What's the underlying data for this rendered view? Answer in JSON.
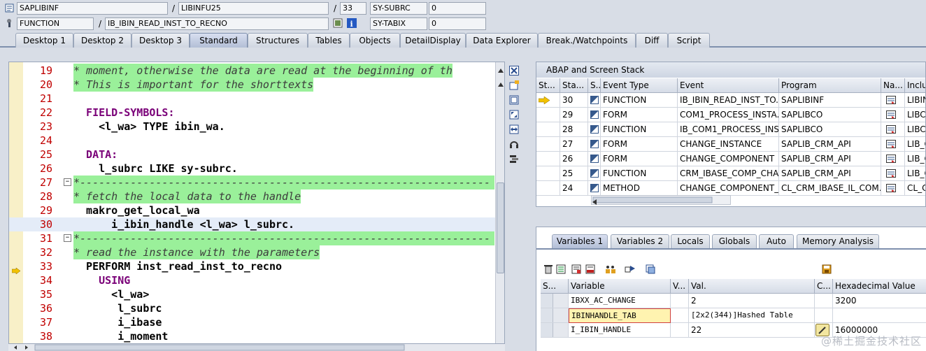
{
  "header": {
    "program": "SAPLIBINF",
    "include": "LIBINFU25",
    "line": "33",
    "subrc_label": "SY-SUBRC",
    "subrc_value": "0",
    "event_type": "FUNCTION",
    "event_name": "IB_IBIN_READ_INST_TO_RECNO",
    "tabix_label": "SY-TABIX",
    "tabix_value": "0",
    "separator": "/"
  },
  "tabs": [
    "Desktop 1",
    "Desktop 2",
    "Desktop 3",
    "Standard",
    "Structures",
    "Tables",
    "Objects",
    "DetailDisplay",
    "Data Explorer",
    "Break./Watchpoints",
    "Diff",
    "Script"
  ],
  "active_tab": "Standard",
  "editor": {
    "lines": [
      {
        "n": "19",
        "text": "* moment, otherwise the data are read at the beginning of th",
        "kind": "comment"
      },
      {
        "n": "20",
        "text": "* This is important for the shorttexts",
        "kind": "comment"
      },
      {
        "n": "21",
        "text": "",
        "kind": "blank"
      },
      {
        "n": "22",
        "text": "  FIELD-SYMBOLS:",
        "kind": "kw"
      },
      {
        "n": "23",
        "text": "    <l_wa> TYPE ibin_wa.",
        "kind": "fs"
      },
      {
        "n": "24",
        "text": "",
        "kind": "blank"
      },
      {
        "n": "25",
        "text": "  DATA:",
        "kind": "kw"
      },
      {
        "n": "26",
        "text": "    l_subrc LIKE sy-subrc.",
        "kind": "data"
      },
      {
        "n": "27",
        "text": "*-----------------------------------------------------------------",
        "kind": "commentfull"
      },
      {
        "n": "28",
        "text": "* fetch the local data to the handle",
        "kind": "comment"
      },
      {
        "n": "29",
        "text": "  makro_get_local_wa",
        "kind": "ident"
      },
      {
        "n": "30",
        "text": "      i_ibin_handle <l_wa> l_subrc.",
        "kind": "ident_cur"
      },
      {
        "n": "31",
        "text": "*-----------------------------------------------------------------",
        "kind": "commentfull"
      },
      {
        "n": "32",
        "text": "* read the instance with the parameters",
        "kind": "comment"
      },
      {
        "n": "33",
        "text": "  PERFORM inst_read_inst_to_recno",
        "kind": "perform"
      },
      {
        "n": "34",
        "text": "    USING",
        "kind": "kw"
      },
      {
        "n": "35",
        "text": "      <l_wa>",
        "kind": "ident"
      },
      {
        "n": "36",
        "text": "       l_subrc",
        "kind": "ident"
      },
      {
        "n": "37",
        "text": "       i_ibase",
        "kind": "ident"
      },
      {
        "n": "38",
        "text": "       i_moment",
        "kind": "ident"
      }
    ]
  },
  "stack": {
    "title": "ABAP and Screen Stack",
    "columns": [
      "St...",
      "Sta...",
      "S...",
      "Event Type",
      "Event",
      "Program",
      "Na...",
      "Include"
    ],
    "rows": [
      {
        "level": "30",
        "type": "FUNCTION",
        "event": "IB_IBIN_READ_INST_TO...",
        "program": "SAPLIBINF",
        "include": "LIBINF",
        "current": true
      },
      {
        "level": "29",
        "type": "FORM",
        "event": "COM1_PROCESS_INSTA...",
        "program": "SAPLIBCO",
        "include": "LIBCO"
      },
      {
        "level": "28",
        "type": "FUNCTION",
        "event": "IB_COM1_PROCESS_INS...",
        "program": "SAPLIBCO",
        "include": "LIBCO"
      },
      {
        "level": "27",
        "type": "FORM",
        "event": "CHANGE_INSTANCE",
        "program": "SAPLIB_CRM_API",
        "include": "LIB_C"
      },
      {
        "level": "26",
        "type": "FORM",
        "event": "CHANGE_COMPONENT",
        "program": "SAPLIB_CRM_API",
        "include": "LIB_C"
      },
      {
        "level": "25",
        "type": "FUNCTION",
        "event": "CRM_IBASE_COMP_CHA...",
        "program": "SAPLIB_CRM_API",
        "include": "LIB_C"
      },
      {
        "level": "24",
        "type": "METHOD",
        "event": "CHANGE_COMPONENT_...",
        "program": "CL_CRM_IBASE_IL_COM...",
        "include": "CL_CR"
      }
    ]
  },
  "variables": {
    "tabs": [
      "Variables 1",
      "Variables 2",
      "Locals",
      "Globals",
      "Auto",
      "Memory Analysis"
    ],
    "active_tab": "Variables 1",
    "columns": [
      "S...",
      "Variable",
      "V...",
      "Val.",
      "C...",
      "Hexadecimal Value"
    ],
    "rows": [
      {
        "name": "IBXX_AC_CHANGE",
        "value": "2",
        "hex": "3200"
      },
      {
        "name": "IBINHANDLE_TAB",
        "value": "[2x2(344)]Hashed Table",
        "hex": "",
        "editing": true
      },
      {
        "name": "I_IBIN_HANDLE",
        "value": "22",
        "hex": "16000000",
        "has_edit": true
      }
    ]
  },
  "watermark": "@稀土掘金技术社区"
}
